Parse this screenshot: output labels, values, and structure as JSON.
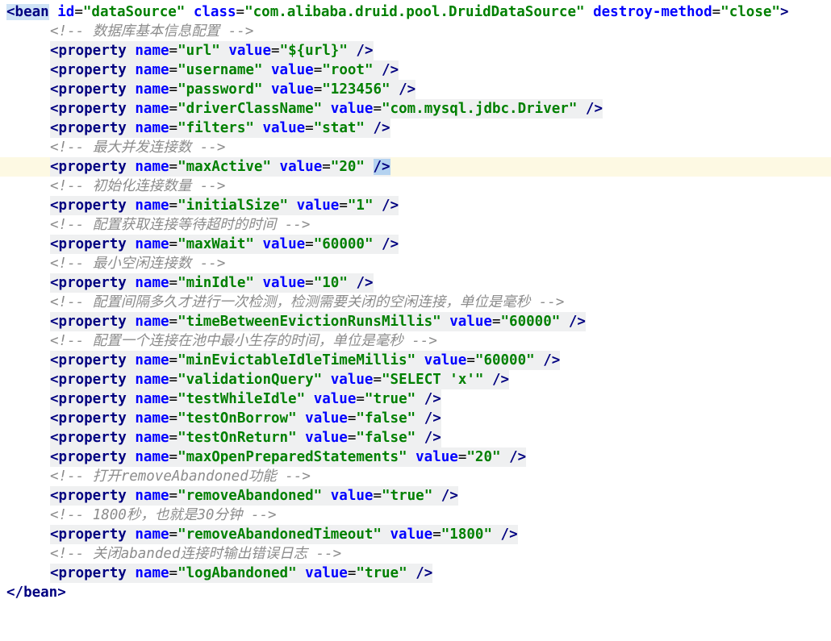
{
  "bean": {
    "open_start": "<bean",
    "attrs": [
      {
        "name": "id",
        "value": "dataSource"
      },
      {
        "name": "class",
        "value": "com.alibaba.druid.pool.DruidDataSource"
      },
      {
        "name": "destroy-method",
        "value": "close"
      }
    ],
    "open_end": ">",
    "close": "</bean>"
  },
  "property_tag": "<property",
  "tag_end": "/>",
  "attr_name": "name",
  "attr_value": "value",
  "comment_open": "<!--",
  "comment_close": "-->",
  "lines": [
    {
      "type": "comment",
      "text": "数据库基本信息配置"
    },
    {
      "type": "prop",
      "name": "url",
      "value": "${url}"
    },
    {
      "type": "prop",
      "name": "username",
      "value": "root"
    },
    {
      "type": "prop",
      "name": "password",
      "value": "123456"
    },
    {
      "type": "prop",
      "name": "driverClassName",
      "value": "com.mysql.jdbc.Driver"
    },
    {
      "type": "prop",
      "name": "filters",
      "value": "stat"
    },
    {
      "type": "comment",
      "text": "最大并发连接数"
    },
    {
      "type": "prop",
      "name": "maxActive",
      "value": "20",
      "current": true
    },
    {
      "type": "comment",
      "text": "初始化连接数量"
    },
    {
      "type": "prop",
      "name": "initialSize",
      "value": "1"
    },
    {
      "type": "comment",
      "text": "配置获取连接等待超时的时间"
    },
    {
      "type": "prop",
      "name": "maxWait",
      "value": "60000"
    },
    {
      "type": "comment",
      "text": "最小空闲连接数"
    },
    {
      "type": "prop",
      "name": "minIdle",
      "value": "10"
    },
    {
      "type": "comment",
      "text": "配置间隔多久才进行一次检测，检测需要关闭的空闲连接，单位是毫秒"
    },
    {
      "type": "prop",
      "name": "timeBetweenEvictionRunsMillis",
      "value": "60000"
    },
    {
      "type": "comment",
      "text": "配置一个连接在池中最小生存的时间，单位是毫秒"
    },
    {
      "type": "prop",
      "name": "minEvictableIdleTimeMillis",
      "value": "60000"
    },
    {
      "type": "prop",
      "name": "validationQuery",
      "value": "SELECT 'x'"
    },
    {
      "type": "prop",
      "name": "testWhileIdle",
      "value": "true"
    },
    {
      "type": "prop",
      "name": "testOnBorrow",
      "value": "false"
    },
    {
      "type": "prop",
      "name": "testOnReturn",
      "value": "false"
    },
    {
      "type": "prop",
      "name": "maxOpenPreparedStatements",
      "value": "20"
    },
    {
      "type": "comment",
      "text": "打开removeAbandoned功能"
    },
    {
      "type": "prop",
      "name": "removeAbandoned",
      "value": "true"
    },
    {
      "type": "comment",
      "text": "1800秒，也就是30分钟"
    },
    {
      "type": "prop",
      "name": "removeAbandonedTimeout",
      "value": "1800"
    },
    {
      "type": "comment",
      "text": "关闭abanded连接时输出错误日志"
    },
    {
      "type": "prop",
      "name": "logAbandoned",
      "value": "true"
    }
  ]
}
